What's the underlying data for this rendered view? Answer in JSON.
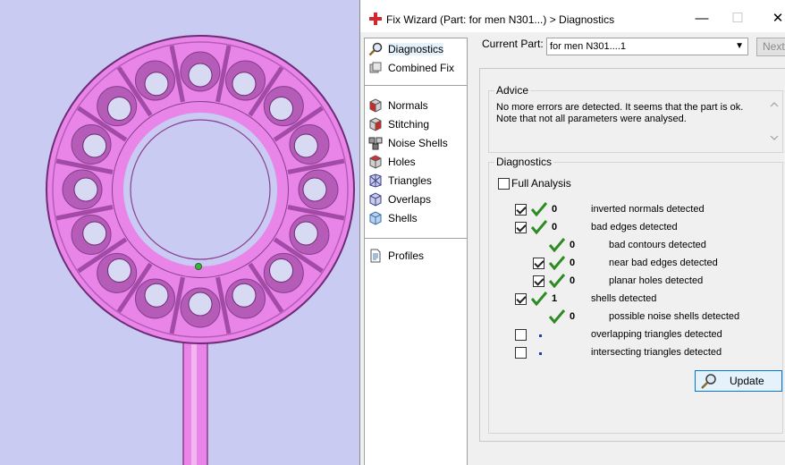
{
  "window": {
    "title": "Fix Wizard (Part: for men N301...) > Diagnostics",
    "minimize_symbol": "—",
    "maximize_symbol": "☐",
    "close_symbol": "✕"
  },
  "nav": {
    "items": [
      {
        "label": "Diagnostics",
        "icon": "magnifier-icon",
        "selected": true
      },
      {
        "label": "Combined Fix",
        "icon": "combined-fix-icon"
      },
      {
        "label": "Normals",
        "icon": "normals-cube-icon"
      },
      {
        "label": "Stitching",
        "icon": "stitching-cube-icon"
      },
      {
        "label": "Noise Shells",
        "icon": "noise-shells-icon"
      },
      {
        "label": "Holes",
        "icon": "holes-cube-icon"
      },
      {
        "label": "Triangles",
        "icon": "triangles-icon"
      },
      {
        "label": "Overlaps",
        "icon": "overlaps-icon"
      },
      {
        "label": "Shells",
        "icon": "shells-icon"
      },
      {
        "label": "Profiles",
        "icon": "profiles-document-icon"
      }
    ]
  },
  "current_part": {
    "label": "Current Part:",
    "value": "for men N301....1",
    "next_label": "Next"
  },
  "advice": {
    "title": "Advice",
    "line1": "No more errors are detected. It seems that the part is ok.",
    "line2": "Note that not all parameters were analysed."
  },
  "diagnostics": {
    "title": "Diagnostics",
    "full_analysis_label": "Full Analysis",
    "full_analysis_checked": false,
    "rows": [
      {
        "count": "0",
        "label": "inverted normals detected",
        "checkbox": true,
        "checked": true,
        "status": "ok"
      },
      {
        "count": "0",
        "label": "bad edges detected",
        "checkbox": true,
        "checked": true,
        "status": "ok"
      },
      {
        "count": "0",
        "label": "bad contours detected",
        "checkbox": false,
        "status": "ok"
      },
      {
        "count": "0",
        "label": "near bad edges detected",
        "checkbox": true,
        "checked": true,
        "status": "ok"
      },
      {
        "count": "0",
        "label": "planar holes detected",
        "checkbox": true,
        "checked": true,
        "status": "ok"
      },
      {
        "count": "1",
        "label": "shells detected",
        "checkbox": true,
        "checked": true,
        "status": "ok"
      },
      {
        "count": "0",
        "label": "possible noise shells detected",
        "checkbox": false,
        "status": "ok"
      },
      {
        "count": "",
        "label": "overlapping triangles detected",
        "checkbox": true,
        "checked": false,
        "status": "none"
      },
      {
        "count": "",
        "label": "intersecting triangles detected",
        "checkbox": true,
        "checked": false,
        "status": "none"
      }
    ],
    "update_label": "Update"
  },
  "colors": {
    "viewport_bg": "#c9cbf3",
    "part_pink": "#e985e8",
    "part_dark": "#a14aa6",
    "tick_green": "#2e8b23",
    "accent_blue": "#0078d7"
  }
}
